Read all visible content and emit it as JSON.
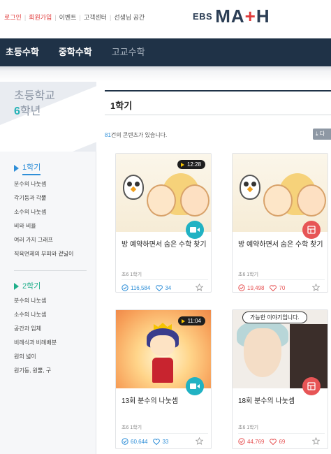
{
  "header": {
    "links": [
      {
        "label": "로그인",
        "accent": true
      },
      {
        "label": "회원가입",
        "accent": true
      },
      {
        "label": "이벤트",
        "accent": false
      },
      {
        "label": "고객센터",
        "accent": false
      },
      {
        "label": "선생님 공간",
        "accent": false
      }
    ],
    "logo_prefix": "EBS",
    "logo_main_a": "MA",
    "logo_main_plus": "+",
    "logo_main_b": "H"
  },
  "nav": {
    "items": [
      "초등수학",
      "중학수학",
      "고교수학"
    ]
  },
  "sidebar": {
    "level": "초등학교",
    "grade_num": "6",
    "grade_suffix": "학년",
    "semesters": [
      {
        "label": "1학기",
        "topics": [
          "분수의 나눗셈",
          "각기둥과 각뿔",
          "소수의 나눗셈",
          "비와 비율",
          "여러 가지 그래프",
          "직육면체의 부피와 겉넓이"
        ]
      },
      {
        "label": "2학기",
        "topics": [
          "분수의 나눗셈",
          "소수의 나눗셈",
          "공간과 입체",
          "비례식과 비례배분",
          "원의 넓이",
          "원기둥, 원뿔, 구"
        ]
      }
    ]
  },
  "main": {
    "section_title": "1학기",
    "count_num": "81",
    "count_suffix": "건의 콘텐츠가 있습니다.",
    "download_label": "다",
    "cards": [
      {
        "title": "방 예약하면서 숨은 수학 찾기",
        "grade": "초6 1학기",
        "views": "116,584",
        "likes": "34",
        "duration": "12:28",
        "type": "video"
      },
      {
        "title": "방 예약하면서 숨은 수학 찾기",
        "grade": "초6 1학기",
        "views": "19,498",
        "likes": "70",
        "duration": "",
        "type": "webtoon"
      },
      {
        "title": "13회 분수의 나눗셈",
        "grade": "초6 1학기",
        "views": "60,644",
        "likes": "33",
        "duration": "11:04",
        "type": "video"
      },
      {
        "title": "18회 분수의 나눗셈",
        "grade": "초6 1학기",
        "views": "44,769",
        "likes": "69",
        "duration": "",
        "type": "webtoon",
        "bubble": "가능한 이야기입니다."
      }
    ]
  },
  "colors": {
    "nav_bg": "#1f3247",
    "accent_red": "#e03a3a",
    "accent_blue": "#2f8fd8",
    "accent_green": "#1fae8a",
    "video_btn": "#21b2c3",
    "webtoon_btn": "#e75556"
  },
  "icons": [
    "play-icon",
    "video-icon",
    "webtoon-icon",
    "view-check-icon",
    "heart-icon",
    "star-icon",
    "download-icon",
    "triangle-icon"
  ]
}
